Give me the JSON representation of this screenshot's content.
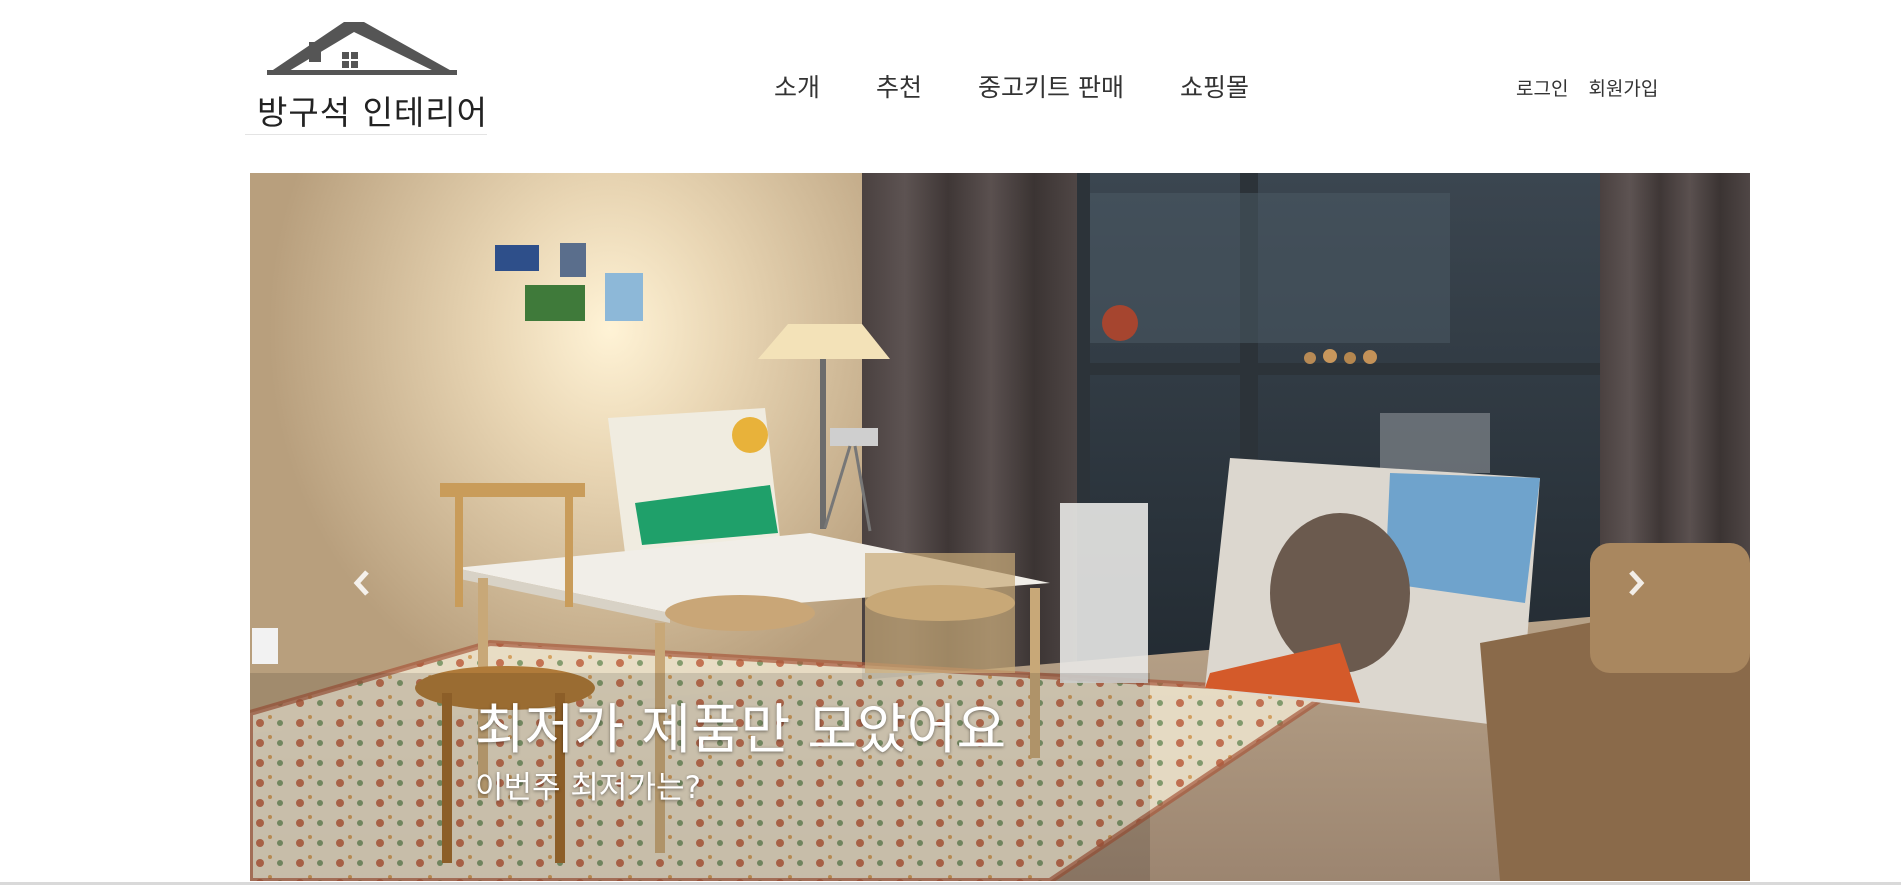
{
  "header": {
    "logo_text": "방구석 인테리어",
    "nav": [
      {
        "label": "소개"
      },
      {
        "label": "추천"
      },
      {
        "label": "중고키트 판매"
      },
      {
        "label": "쇼핑몰"
      }
    ],
    "auth": {
      "login": "로그인",
      "signup": "회원가입"
    }
  },
  "hero": {
    "title": "최저가 제품만 모았어요",
    "subtitle": "이번주 최저가는?",
    "prev_icon": "chevron-left-icon",
    "next_icon": "chevron-right-icon"
  },
  "colors": {
    "logo_roof": "#555555",
    "text": "#333333",
    "caption": "#ffffff"
  }
}
